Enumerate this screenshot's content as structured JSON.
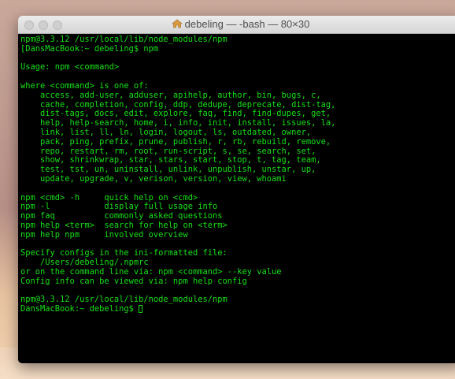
{
  "window": {
    "title": "debeling — -bash — 80×30"
  },
  "terminal": {
    "lines": [
      "npm@3.3.12 /usr/local/lib/node_modules/npm",
      "[DansMacBook:~ debeling$ npm",
      "",
      "Usage: npm <command>",
      "",
      "where <command> is one of:",
      "    access, add-user, adduser, apihelp, author, bin, bugs, c,",
      "    cache, completion, config, ddp, dedupe, deprecate, dist-tag,",
      "    dist-tags, docs, edit, explore, faq, find, find-dupes, get,",
      "    help, help-search, home, i, info, init, install, issues, la,",
      "    link, list, ll, ln, login, logout, ls, outdated, owner,",
      "    pack, ping, prefix, prune, publish, r, rb, rebuild, remove,",
      "    repo, restart, rm, root, run-script, s, se, search, set,",
      "    show, shrinkwrap, star, stars, start, stop, t, tag, team,",
      "    test, tst, un, uninstall, unlink, unpublish, unstar, up,",
      "    update, upgrade, v, verison, version, view, whoami",
      "",
      "npm <cmd> -h     quick help on <cmd>",
      "npm -l           display full usage info",
      "npm faq          commonly asked questions",
      "npm help <term>  search for help on <term>",
      "npm help npm     involved overview",
      "",
      "Specify configs in the ini-formatted file:",
      "    /Users/debeling/.npmrc",
      "or on the command line via: npm <command> --key value",
      "Config info can be viewed via: npm help config",
      "",
      "npm@3.3.12 /usr/local/lib/node_modules/npm"
    ],
    "prompt": "DansMacBook:~ debeling$ "
  },
  "colors": {
    "terminal_text": "#16e016",
    "terminal_bg": "#000000"
  }
}
